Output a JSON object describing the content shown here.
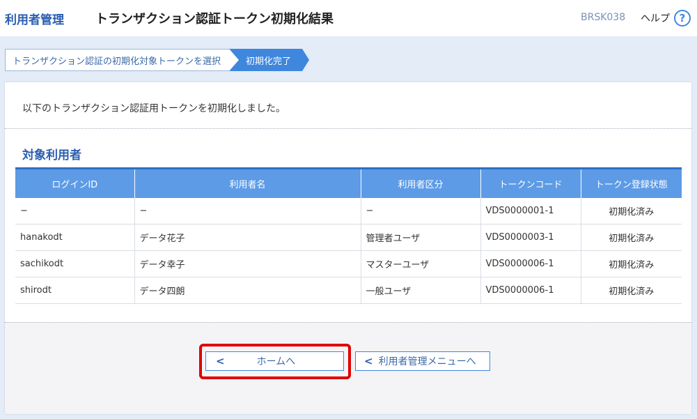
{
  "header": {
    "section_title": "利用者管理",
    "screen_title": "トランザクション認証トークン初期化結果",
    "screen_id": "BRSK038",
    "help_label": "ヘルプ",
    "help_icon": "?"
  },
  "steps": [
    {
      "label": "トランザクション認証の初期化対象トークンを選択"
    },
    {
      "label": "初期化完了"
    }
  ],
  "message": "以下のトランザクション認証用トークンを初期化しました。",
  "target_heading": "対象利用者",
  "table": {
    "headers": [
      "ログインID",
      "利用者名",
      "利用者区分",
      "トークンコード",
      "トークン登録状態"
    ],
    "rows": [
      [
        "−",
        "−",
        "−",
        "VDS0000001-1",
        "初期化済み"
      ],
      [
        "hanakodt",
        "データ花子",
        "管理者ユーザ",
        "VDS0000003-1",
        "初期化済み"
      ],
      [
        "sachikodt",
        "データ幸子",
        "マスターユーザ",
        "VDS0000006-1",
        "初期化済み"
      ],
      [
        "shirodt",
        "データ四朗",
        "一般ユーザ",
        "VDS0000006-1",
        "初期化済み"
      ]
    ]
  },
  "buttons": {
    "home_label": "ホームへ",
    "menu_label": "利用者管理メニューへ",
    "chevron": "<"
  },
  "colors": {
    "accent": "#3f86dd",
    "highlight": "#e00000"
  }
}
